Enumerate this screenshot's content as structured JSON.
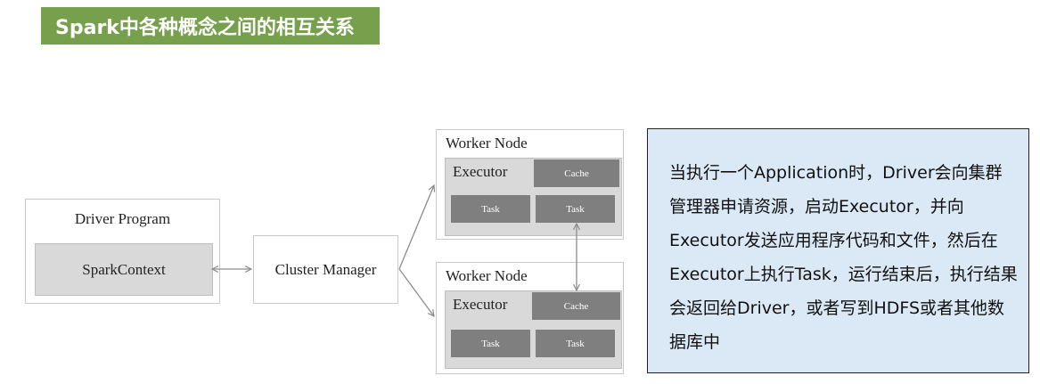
{
  "title": "Spark中各种概念之间的相互关系",
  "driver": {
    "label": "Driver Program",
    "context": "SparkContext"
  },
  "cluster_manager": "Cluster Manager",
  "workers": [
    {
      "label": "Worker Node",
      "executor": "Executor",
      "cache": "Cache",
      "tasks": [
        "Task",
        "Task"
      ]
    },
    {
      "label": "Worker Node",
      "executor": "Executor",
      "cache": "Cache",
      "tasks": [
        "Task",
        "Task"
      ]
    }
  ],
  "description": "当执行一个Application时，Driver会向集群管理器申请资源，启动Executor，并向Executor发送应用程序代码和文件，然后在Executor上执行Task，运行结束后，执行结果会返回给Driver，或者写到HDFS或者其他数据库中",
  "colors": {
    "title_bg": "#77a04d",
    "box_fill": "#d9d9d9",
    "dark_fill": "#7f7f7f",
    "info_bg": "#dbe8f5",
    "connector": "#8c8c8c"
  }
}
